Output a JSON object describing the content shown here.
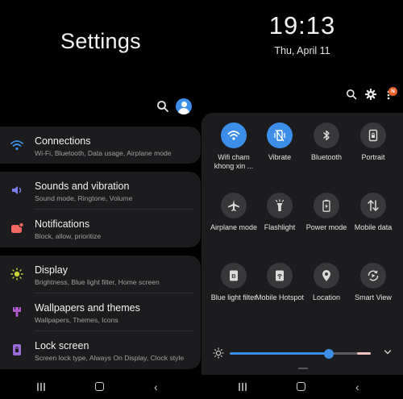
{
  "settings": {
    "title": "Settings",
    "groups": [
      [
        {
          "title": "Connections",
          "subtitle": "Wi-Fi, Bluetooth, Data usage, Airplane mode",
          "icon": "wifi-icon",
          "color": "#3d8ee8"
        }
      ],
      [
        {
          "title": "Sounds and vibration",
          "subtitle": "Sound mode, Ringtone, Volume",
          "icon": "speaker-icon",
          "color": "#7b7ff0"
        },
        {
          "title": "Notifications",
          "subtitle": "Block, allow, prioritize",
          "icon": "notification-icon",
          "color": "#f06a62"
        }
      ],
      [
        {
          "title": "Display",
          "subtitle": "Brightness, Blue light filter, Home screen",
          "icon": "sun-icon",
          "color": "#c8d63a"
        },
        {
          "title": "Wallpapers and themes",
          "subtitle": "Wallpapers, Themes, Icons",
          "icon": "brush-icon",
          "color": "#b05ad0"
        },
        {
          "title": "Lock screen",
          "subtitle": "Screen lock type, Always On Display, Clock style",
          "icon": "lock-icon",
          "color": "#9a6ad6"
        }
      ]
    ]
  },
  "quick_panel": {
    "time": "19:13",
    "date": "Thu, April 11",
    "badge": "N",
    "tiles": [
      {
        "label": "Wifi cham khong xin ...",
        "icon": "wifi-icon",
        "on": true
      },
      {
        "label": "Vibrate",
        "icon": "vibrate-icon",
        "on": true
      },
      {
        "label": "Bluetooth",
        "icon": "bluetooth-icon",
        "on": false
      },
      {
        "label": "Portrait",
        "icon": "portrait-lock-icon",
        "on": false
      },
      {
        "label": "Airplane mode",
        "icon": "airplane-icon",
        "on": false
      },
      {
        "label": "Flashlight",
        "icon": "flashlight-icon",
        "on": false
      },
      {
        "label": "Power mode",
        "icon": "power-mode-icon",
        "on": false
      },
      {
        "label": "Mobile data",
        "icon": "mobile-data-icon",
        "on": false
      },
      {
        "label": "Blue light filter",
        "icon": "blue-light-icon",
        "on": false
      },
      {
        "label": "Mobile Hotspot",
        "icon": "hotspot-icon",
        "on": false
      },
      {
        "label": "Location",
        "icon": "location-icon",
        "on": false
      },
      {
        "label": "Smart View",
        "icon": "smart-view-icon",
        "on": false
      }
    ],
    "brightness": 0.7,
    "page": 1,
    "pages": 2
  },
  "colors": {
    "accent": "#3d8ee8",
    "card": "#1c1c1e",
    "badge": "#e8632c"
  }
}
